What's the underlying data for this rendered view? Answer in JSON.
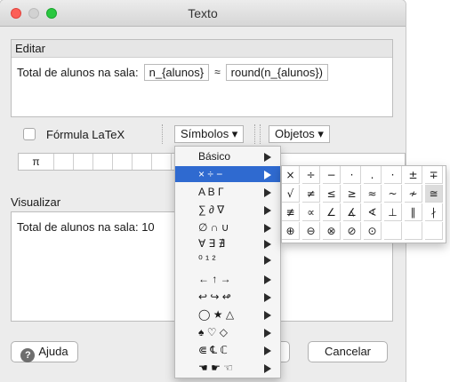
{
  "window": {
    "title": "Texto"
  },
  "editor": {
    "section_title": "Editar",
    "prefix_text": "Total de alunos na sala:",
    "field1": "n_{alunos}",
    "approx_symbol": "≈",
    "field2": "round(n_{alunos})"
  },
  "latex_toggle": {
    "label": "Fórmula LaTeX",
    "checked": false
  },
  "symbols_menu": {
    "label": "Símbolos ▾"
  },
  "objects_menu": {
    "label": "Objetos ▾"
  },
  "symbol_strip": {
    "first": "π"
  },
  "preview": {
    "section_title": "Visualizar",
    "text": "Total de alunos na sala:  10"
  },
  "buttons": {
    "help": "Ajuda",
    "cancel": "Cancelar"
  },
  "dropdown_items": [
    {
      "label": "Básico"
    },
    {
      "label": "× ÷ −"
    },
    {
      "label": "A B Γ"
    },
    {
      "label": "∑ ∂ ∇"
    },
    {
      "label": "∅ ∩ ∪"
    },
    {
      "label": "∀ ∃ ∄"
    },
    {
      "label": "⁰ ¹ ²"
    },
    {
      "label": "← ↑ →"
    },
    {
      "label": "↩ ↪ ↫"
    },
    {
      "label": "◯ ★ △"
    },
    {
      "label": "♠ ♡ ◇"
    },
    {
      "label": "⋐ ℄ ℂ"
    },
    {
      "label": "☚ ☛ ☜"
    }
  ],
  "operator_grid": [
    [
      "×",
      "÷",
      "−",
      "·",
      ".",
      "·",
      "±",
      "∓"
    ],
    [
      "√",
      "≠",
      "≤",
      "≥",
      "≈",
      "~",
      "≁",
      "≅"
    ],
    [
      "≢",
      "∝",
      "∠",
      "∡",
      "∢",
      "⊥",
      "∥",
      "∤"
    ],
    [
      "⊕",
      "⊖",
      "⊗",
      "⊘",
      "⊙",
      "",
      "",
      ""
    ]
  ],
  "colors": {
    "selection": "#2f6ad0",
    "close": "#fc5f57",
    "maximize": "#2ac840"
  }
}
